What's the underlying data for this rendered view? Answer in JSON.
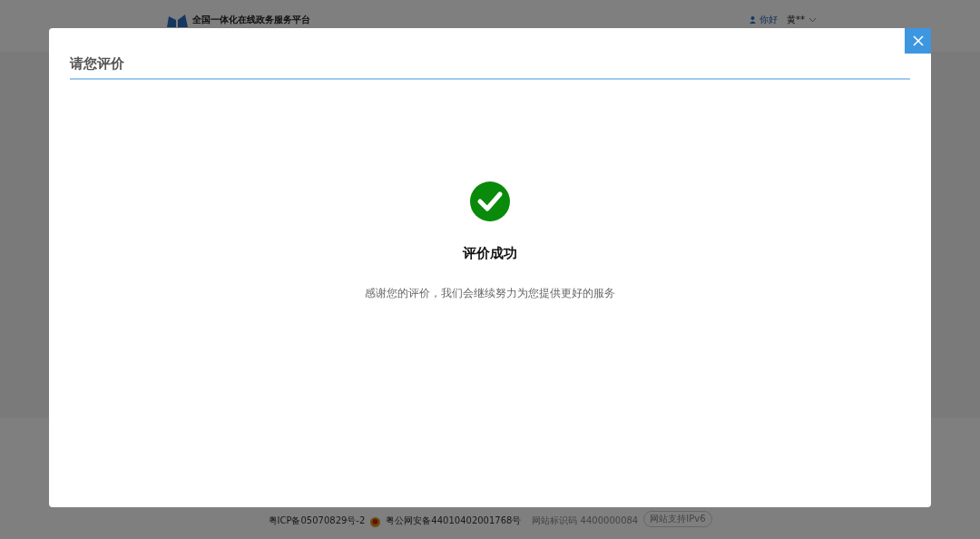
{
  "header": {
    "platform_subtitle": "全国一体化在线政务服务平台",
    "greeting": "你好",
    "user_name": "黄**"
  },
  "footer": {
    "icp": "粤ICP备05070829号-2",
    "police_record": "粤公网安备44010402001768号",
    "site_code": "网站标识码 4400000084",
    "ipv6_badge": "网站支持IPv6"
  },
  "dialog": {
    "title": "请您评价",
    "result_title": "评价成功",
    "message": "感谢您的评价，我们会继续努力为您提供更好的服务"
  }
}
